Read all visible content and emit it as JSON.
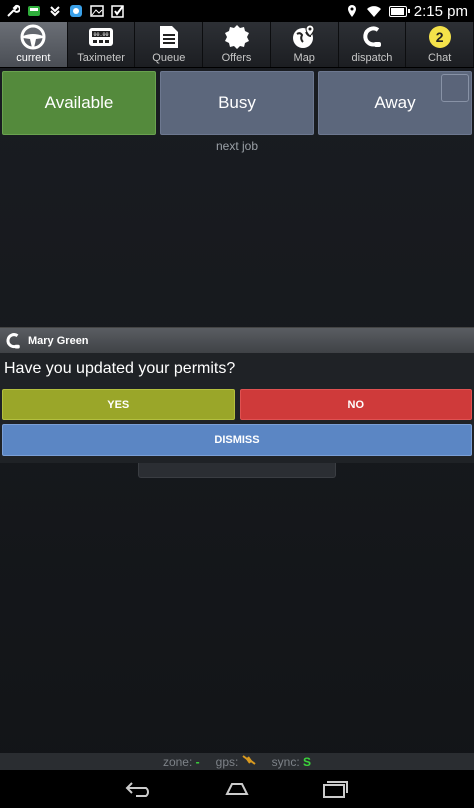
{
  "statusbar": {
    "time": "2:15",
    "ampm": "pm",
    "left_icons": [
      "wrench-icon",
      "taxi-icon",
      "download-icon",
      "app-icon",
      "image-icon",
      "checkbox-icon"
    ],
    "right_icons": [
      "location-icon",
      "wifi-icon",
      "battery-icon"
    ]
  },
  "tabs": [
    {
      "label": "current",
      "icon": "steering-wheel-icon",
      "active": true
    },
    {
      "label": "Taximeter",
      "icon": "taximeter-icon",
      "active": false,
      "meter": "00.00"
    },
    {
      "label": "Queue",
      "icon": "document-icon",
      "active": false
    },
    {
      "label": "Offers",
      "icon": "offers-badge-icon",
      "active": false
    },
    {
      "label": "Map",
      "icon": "globe-pin-icon",
      "active": false
    },
    {
      "label": "dispatch",
      "icon": "headset-icon",
      "active": false
    },
    {
      "label": "Chat",
      "icon": "chat-icon",
      "active": false,
      "badge": "2"
    }
  ],
  "status": {
    "available": "Available",
    "busy": "Busy",
    "away": "Away",
    "colors": {
      "available": "#548a3c",
      "busy": "#5c677c",
      "away": "#5c677c"
    }
  },
  "next_job": "next job",
  "dialog": {
    "sender": "Mary Green",
    "question": "Have you updated your permits?",
    "yes": "YES",
    "no": "NO",
    "dismiss": "DISMISS",
    "colors": {
      "yes": "#9aa629",
      "no": "#cf3a3a",
      "dismiss": "#5b86c4"
    }
  },
  "infobar": {
    "zone_label": "zone:",
    "zone_value": "-",
    "gps_label": "gps:",
    "sync_label": "sync:",
    "sync_value": "S"
  },
  "navbar": {
    "buttons": [
      "back-icon",
      "home-icon",
      "recent-apps-icon"
    ]
  }
}
